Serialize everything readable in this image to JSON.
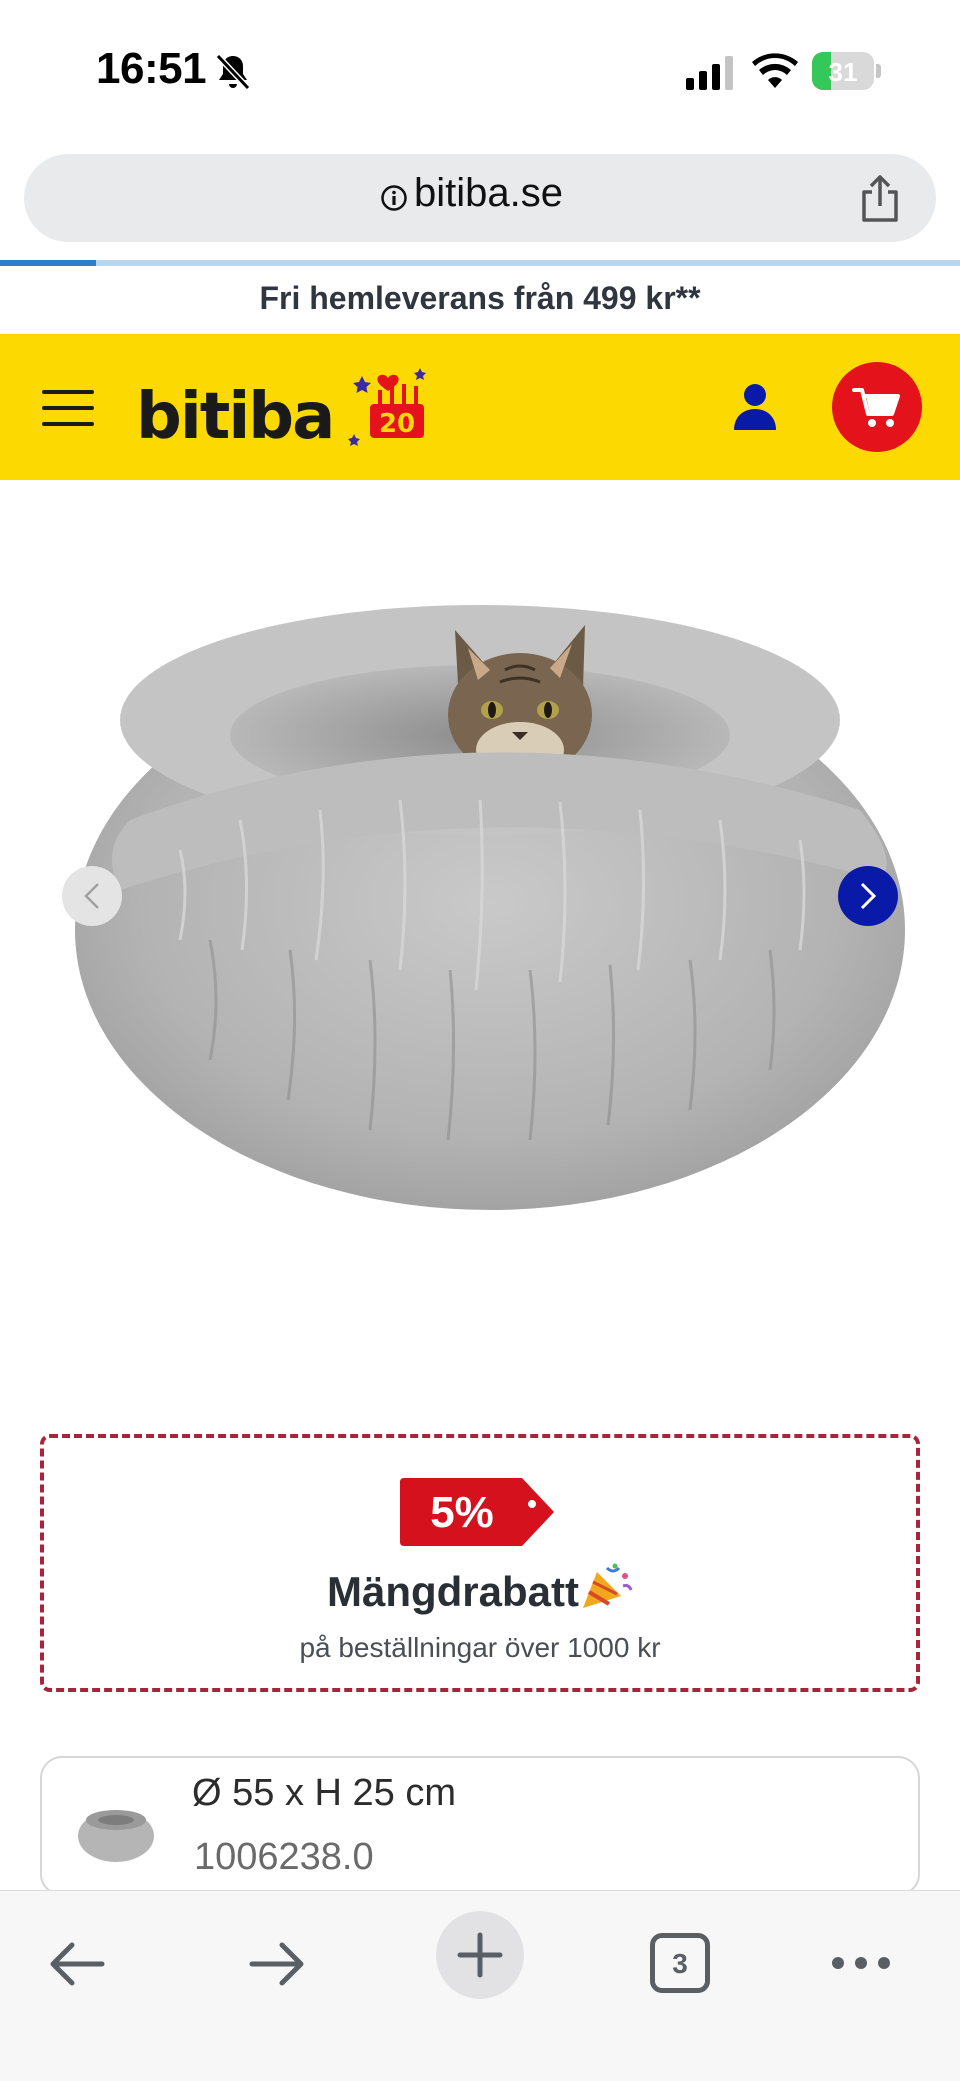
{
  "status_bar": {
    "time": "16:51",
    "battery_percent": 31
  },
  "browser": {
    "url": "bitiba.se",
    "load_progress": 0.1,
    "tab_count": "3"
  },
  "promo": {
    "text": "Fri hemleverans från 499 kr**"
  },
  "header": {
    "logo_text": "bitiba",
    "logo_badge": "20",
    "brand_yellow": "#fcd900",
    "cart_red": "#e3121b",
    "accent_blue": "#0a1aa8"
  },
  "carousel": {
    "prev_icon": "chevron-left-icon",
    "next_icon": "chevron-right-icon"
  },
  "discount": {
    "percent": "5%",
    "title": "Mängdrabatt",
    "subtitle": "på beställningar över 1000 kr",
    "border_color": "#a8243b"
  },
  "variant": {
    "size": "Ø 55 x H 25 cm",
    "sku": "1006238.0"
  }
}
